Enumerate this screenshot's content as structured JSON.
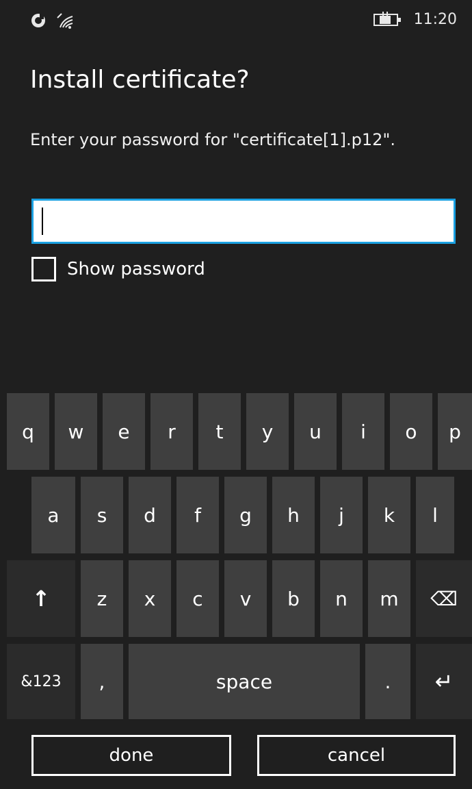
{
  "status": {
    "time": "11:20",
    "icons": [
      "notification-icon",
      "wifi-icon",
      "battery-charging-icon"
    ]
  },
  "dialog": {
    "title": "Install certificate?",
    "prompt": "Enter your password for \"certificate[1].p12\".",
    "password_value": "",
    "show_password_label": "Show password",
    "show_password_checked": false,
    "accent_color": "#1ba1e2"
  },
  "keyboard": {
    "row1": [
      "q",
      "w",
      "e",
      "r",
      "t",
      "y",
      "u",
      "i",
      "o",
      "p"
    ],
    "row2": [
      "a",
      "s",
      "d",
      "f",
      "g",
      "h",
      "j",
      "k",
      "l"
    ],
    "row3": [
      "z",
      "x",
      "c",
      "v",
      "b",
      "n",
      "m"
    ],
    "shift_label": "↑",
    "backspace_label": "⌫",
    "symbols_label": "&123",
    "comma_label": ",",
    "space_label": "space",
    "period_label": ".",
    "enter_label": "↵"
  },
  "buttons": {
    "done": "done",
    "cancel": "cancel"
  }
}
